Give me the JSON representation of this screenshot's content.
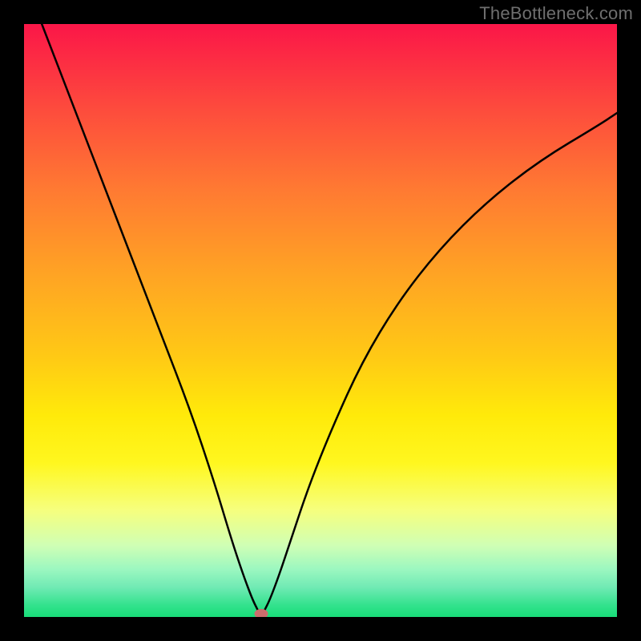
{
  "watermark": "TheBottleneck.com",
  "chart_data": {
    "type": "line",
    "title": "",
    "xlabel": "",
    "ylabel": "",
    "xlim": [
      0,
      100
    ],
    "ylim": [
      0,
      100
    ],
    "min_point": {
      "x": 40,
      "y": 0
    },
    "series": [
      {
        "name": "curve",
        "x": [
          3,
          8,
          13,
          18,
          23,
          28,
          32,
          35,
          37,
          38.5,
          39.5,
          40,
          40.5,
          41.5,
          43,
          45,
          48,
          52,
          57,
          63,
          70,
          78,
          87,
          97,
          100
        ],
        "values": [
          100,
          87,
          74,
          61,
          48,
          35,
          23,
          13,
          7,
          3,
          1,
          0,
          1,
          3,
          7,
          13,
          22,
          32,
          43,
          53,
          62,
          70,
          77,
          83,
          85
        ]
      }
    ],
    "marker": {
      "x": 40,
      "y": 0,
      "color": "#cc6d6d"
    }
  }
}
